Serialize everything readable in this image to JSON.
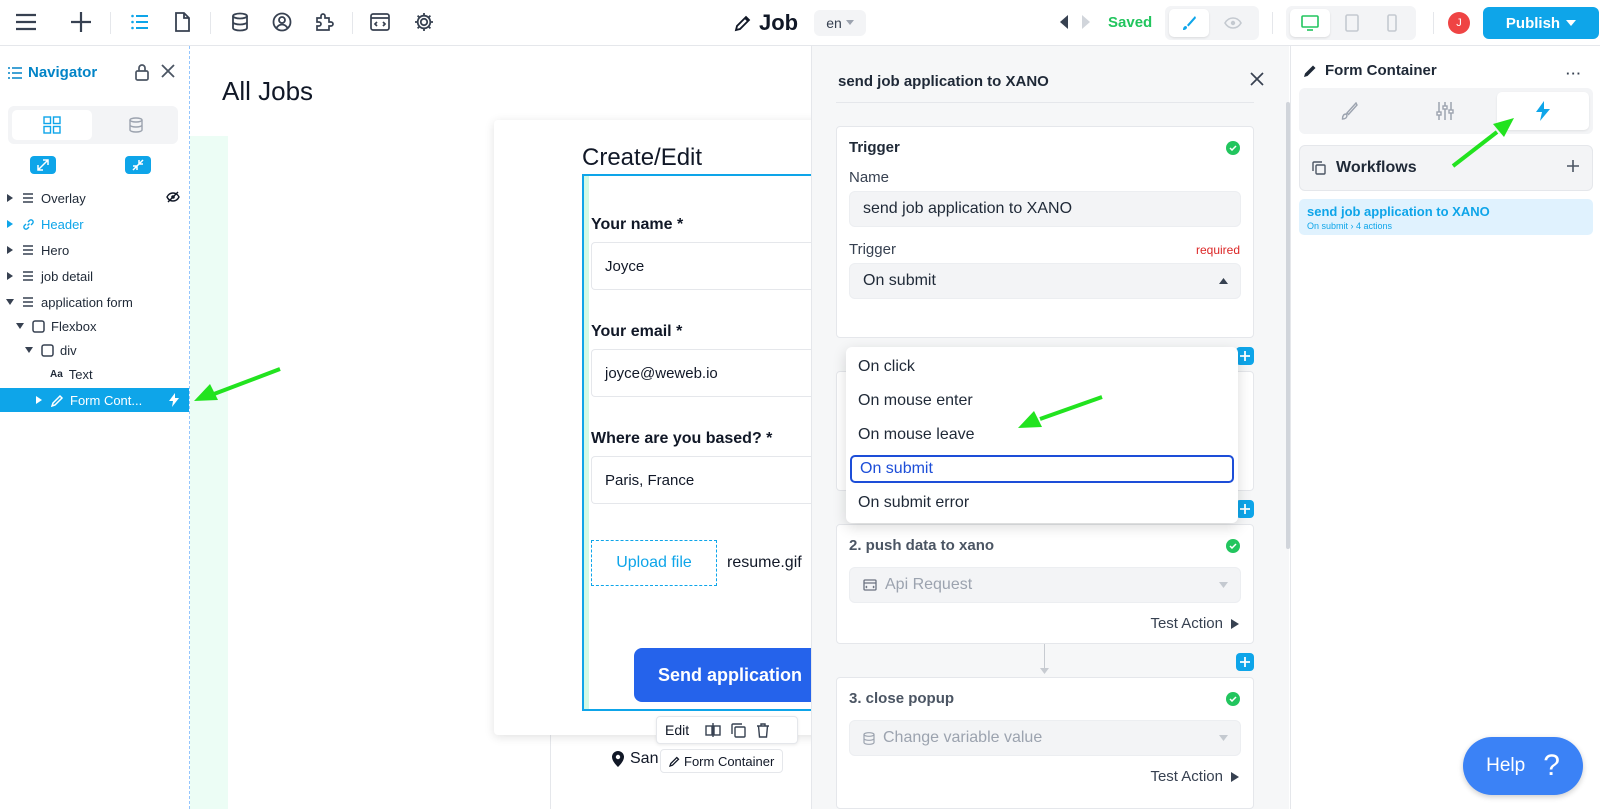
{
  "topbar": {
    "page_title": "Job",
    "language": "en",
    "status": "Saved",
    "avatar_initial": "J",
    "publish_label": "Publish"
  },
  "navigator": {
    "title": "Navigator",
    "tree": [
      {
        "label": "Overlay",
        "icon": "section-icon",
        "expanded": false
      },
      {
        "label": "Header",
        "icon": "link-icon",
        "expanded": false,
        "linked": true
      },
      {
        "label": "Hero",
        "icon": "section-icon",
        "expanded": false
      },
      {
        "label": "job detail",
        "icon": "section-icon",
        "expanded": false
      },
      {
        "label": "application form",
        "icon": "section-icon",
        "expanded": true
      },
      {
        "label": "Flexbox",
        "icon": "box-icon",
        "expanded": true
      },
      {
        "label": "div",
        "icon": "box-icon",
        "expanded": true
      },
      {
        "label": "Text",
        "icon": "text-icon"
      },
      {
        "label": "Form Cont...",
        "icon": "pencil-icon",
        "selected": true
      }
    ],
    "text_icon_glyph": "Aa"
  },
  "canvas": {
    "page_heading": "All Jobs",
    "form_title": "Create/Edit",
    "fields": [
      {
        "label": "Your name *",
        "value": "Joyce"
      },
      {
        "label": "Your email *",
        "value": "joyce@weweb.io"
      },
      {
        "label": "Where are you based? *",
        "value": "Paris, France"
      }
    ],
    "upload_label": "Upload file",
    "file_name": "resume.gif",
    "submit_label": "Send application",
    "toolbar_edit": "Edit",
    "element_tag": "Form Container",
    "location_text": "San F"
  },
  "workflow_panel": {
    "title": "send job application to XANO",
    "trigger_card": {
      "title": "Trigger",
      "name_label": "Name",
      "name_value": "send job application to XANO",
      "trigger_label": "Trigger",
      "required_label": "required",
      "trigger_value": "On submit"
    },
    "dropdown_options": [
      "On click",
      "On mouse enter",
      "On mouse leave",
      "On submit",
      "On submit error"
    ],
    "selected_option_index": 3,
    "actions": [
      {
        "title": "2. push data to xano",
        "action_type": "Api Request",
        "test_label": "Test Action"
      },
      {
        "title": "3. close popup",
        "action_type": "Change variable value",
        "test_label": "Test Action"
      }
    ]
  },
  "right_panel": {
    "title": "Form Container",
    "more": "···",
    "active_tab": "workflows",
    "workflows_label": "Workflows",
    "workflow_item": {
      "name": "send job application to XANO",
      "subtitle": "On submit › 4 actions"
    }
  },
  "help": {
    "label": "Help",
    "icon_glyph": "?"
  },
  "colors": {
    "accent": "#0ea5e9",
    "success": "#22c55e",
    "annotation_arrow": "#22e31f"
  }
}
